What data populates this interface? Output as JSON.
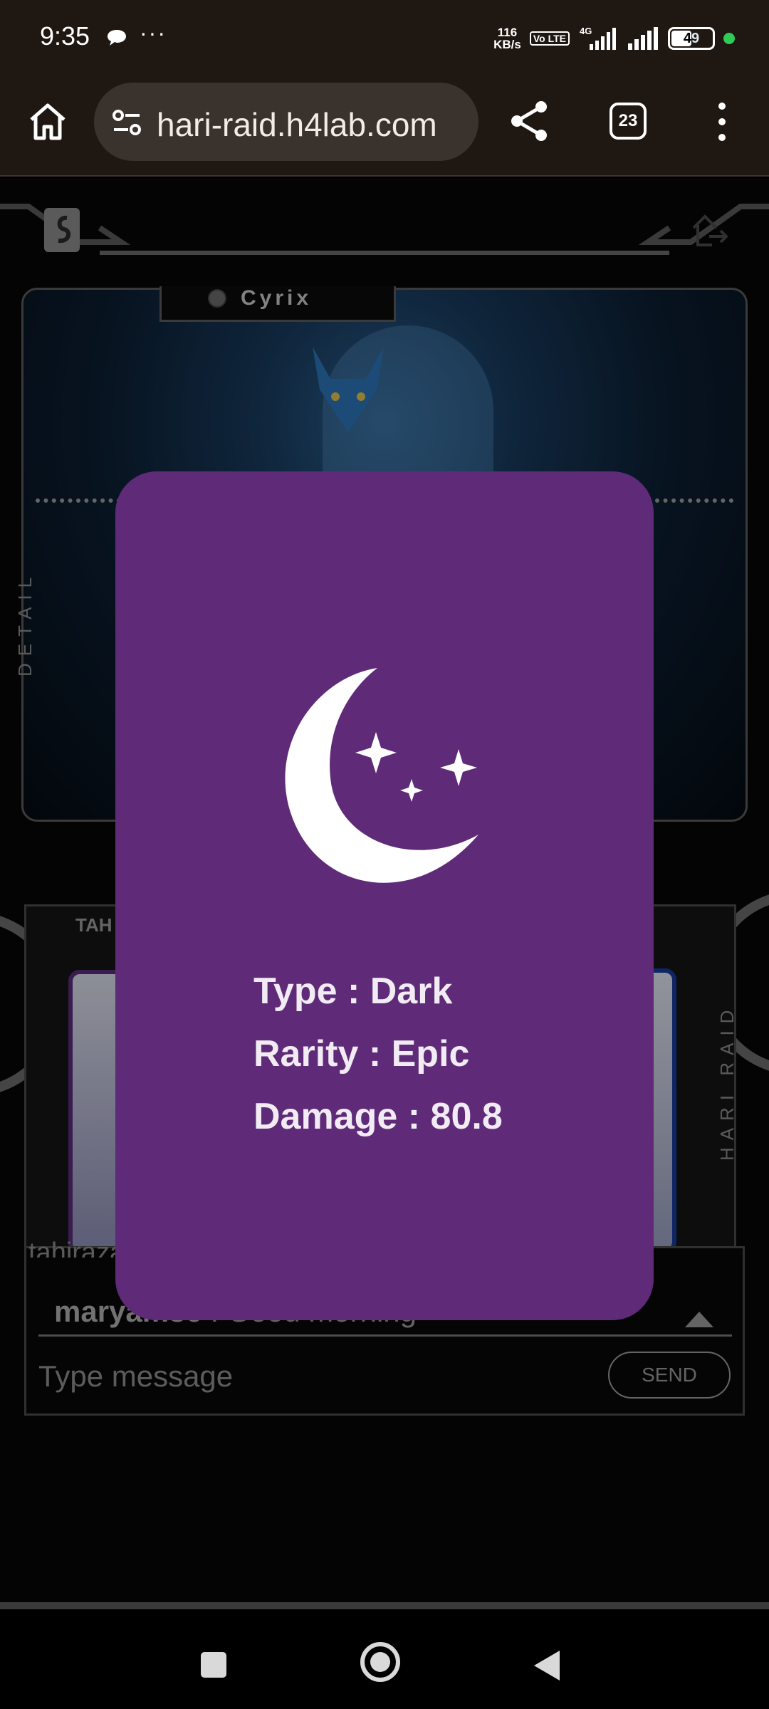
{
  "status_bar": {
    "time": "9:35",
    "more": "···",
    "net_speed_value": "116",
    "net_speed_unit": "KB/s",
    "volte": "Vo LTE",
    "network": "4G",
    "battery": "49"
  },
  "browser": {
    "url": "hari-raid.h4lab.com",
    "tab_count": "23"
  },
  "game": {
    "hero_name": "Cyrix",
    "detail_label": "DETAIL",
    "team_label": "TAH",
    "side_label": "HARI RAID"
  },
  "modal": {
    "type_label": "Type",
    "type_value": "Dark",
    "rarity_label": "Rarity",
    "rarity_value": "Epic",
    "damage_label": "Damage",
    "damage_value": "80.8",
    "separator": " : "
  },
  "chat": {
    "previous_message": "tahirazaman : I tried",
    "last_user": "maryam86",
    "last_message": "Good morning",
    "separator": " :  ",
    "input_placeholder": "Type message",
    "send_label": "SEND"
  },
  "colors": {
    "modal_bg": "#5f2a78",
    "modal_text": "#f1ebf3",
    "chrome_bg": "#1f1712"
  }
}
